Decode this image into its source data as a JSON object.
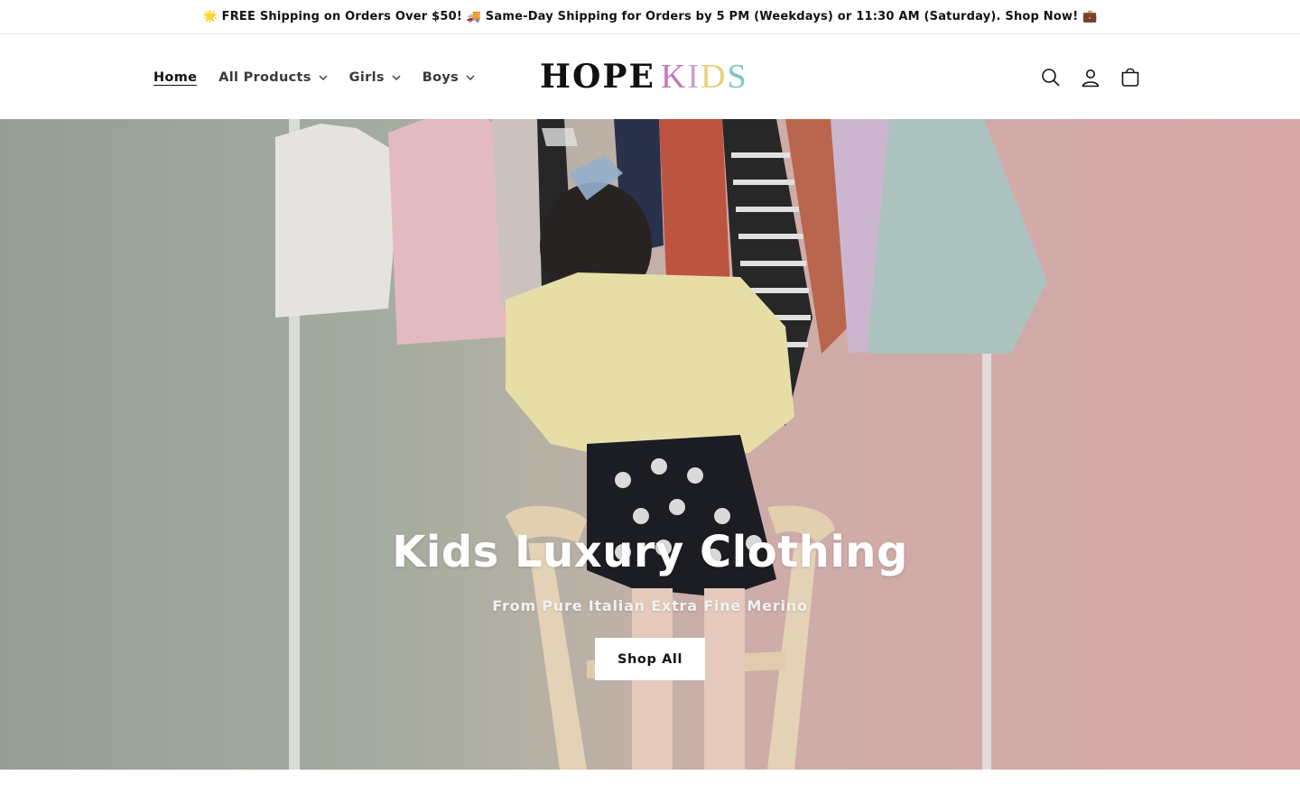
{
  "announcement": {
    "text": "🌟 FREE Shipping on Orders Over $50! 🚚 Same-Day Shipping for Orders by 5 PM (Weekdays) or 11:30 AM (Saturday). Shop Now! 💼"
  },
  "header": {
    "nav": [
      {
        "label": "Home",
        "active": true,
        "has_dropdown": false
      },
      {
        "label": "All Products",
        "has_dropdown": true
      },
      {
        "label": "Girls",
        "has_dropdown": true
      },
      {
        "label": "Boys",
        "has_dropdown": true
      }
    ],
    "logo": {
      "word1": "HOPE",
      "word2_letters": [
        "K",
        "I",
        "D",
        "S"
      ],
      "word2_colors": [
        "#c37ab8",
        "#c8a0c8",
        "#e6d27a",
        "#7fc8c0"
      ]
    },
    "icons": [
      "search-icon",
      "account-icon",
      "cart-icon"
    ]
  },
  "hero": {
    "title": "Kids Luxury Clothing",
    "subtitle": "From Pure Italian Extra Fine Merino",
    "button_label": "Shop All"
  }
}
